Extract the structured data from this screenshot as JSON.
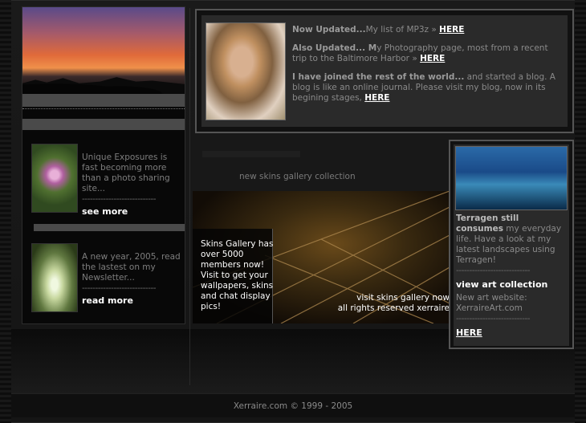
{
  "left": {
    "item1": {
      "text": "Unique Exposures is fast becoming more than a photo sharing site...",
      "separator": "----------------------------",
      "link": "see more"
    },
    "item2": {
      "text": "A new year, 2005, read the lastest on my Newsletter...",
      "separator": "----------------------------",
      "link": "read more"
    }
  },
  "news": {
    "p1": {
      "bold": "Now Updated...",
      "text": "My list of MP3z »",
      "link": "HERE"
    },
    "p2": {
      "bold": "Also Updated... M",
      "text": "y Photography page, most from a recent trip to the Baltimore Harbor »",
      "link": "HERE"
    },
    "p3": {
      "bold": "I have joined the rest of the world...",
      "text": " and started a blog. A blog is like an online journal. Please visit my blog, now in its begining stages,",
      "link": "HERE"
    }
  },
  "gallery": {
    "title": "new skins gallery collection",
    "box_text": "Skins Gallery has over 5000 members now! Visit to get your wallpapers, skins and chat display pics!",
    "visit_link": "visit skins gallery now",
    "rights": "all rights reserved xerraire"
  },
  "right": {
    "heading": "Terragen still consumes",
    "text": " my everyday life. Have a look at my latest landscapes using Terragen!",
    "separator": "----------------------------",
    "link1": "view art collection",
    "text2": "New art website: XerraireArt.com",
    "link2": "HERE"
  },
  "footer": {
    "text": "Xerraire.com © 1999 - 2005"
  }
}
